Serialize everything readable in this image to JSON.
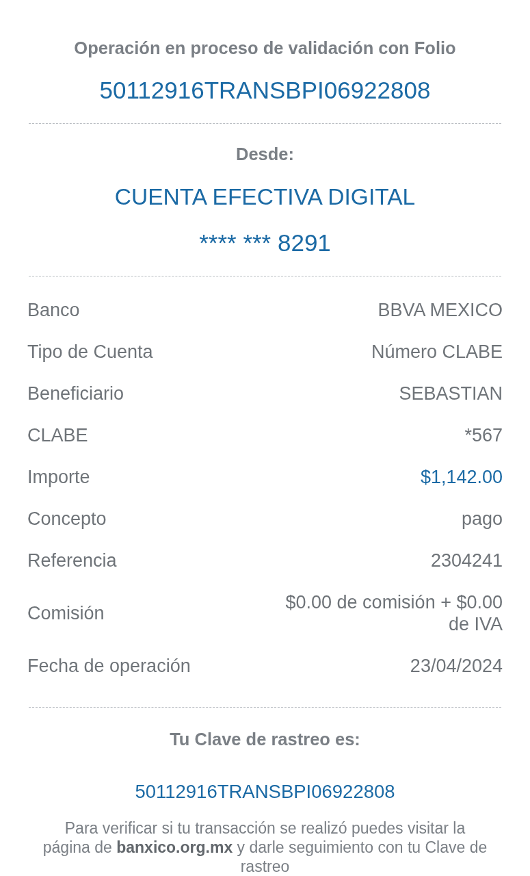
{
  "header": {
    "title": "Operación en proceso de validación con Folio",
    "folio": "50112916TRANSBPI06922808"
  },
  "source": {
    "label": "Desde:",
    "account_name": "CUENTA EFECTIVA DIGITAL",
    "account_number": "**** *** 8291"
  },
  "details": [
    {
      "label": "Banco",
      "value": "BBVA MEXICO",
      "highlighted": false
    },
    {
      "label": "Tipo de Cuenta",
      "value": "Número CLABE",
      "highlighted": false
    },
    {
      "label": "Beneficiario",
      "value": "SEBASTIAN",
      "highlighted": false
    },
    {
      "label": "CLABE",
      "value": "*567",
      "highlighted": false
    },
    {
      "label": "Importe",
      "value": "$1,142.00",
      "highlighted": true
    },
    {
      "label": "Concepto",
      "value": "pago",
      "highlighted": false
    },
    {
      "label": "Referencia",
      "value": "2304241",
      "highlighted": false
    },
    {
      "label": "Comisión",
      "value": "$0.00 de comisión + $0.00 de IVA",
      "highlighted": false
    },
    {
      "label": "Fecha de operación",
      "value": "23/04/2024",
      "highlighted": false
    }
  ],
  "tracking": {
    "title": "Tu Clave de rastreo es:",
    "code": "50112916TRANSBPI06922808",
    "note": "Para verificar si tu transacción se realizó puedes visitar la página de **banxico.org.mx** y darle seguimiento con tu Clave de rastreo"
  }
}
